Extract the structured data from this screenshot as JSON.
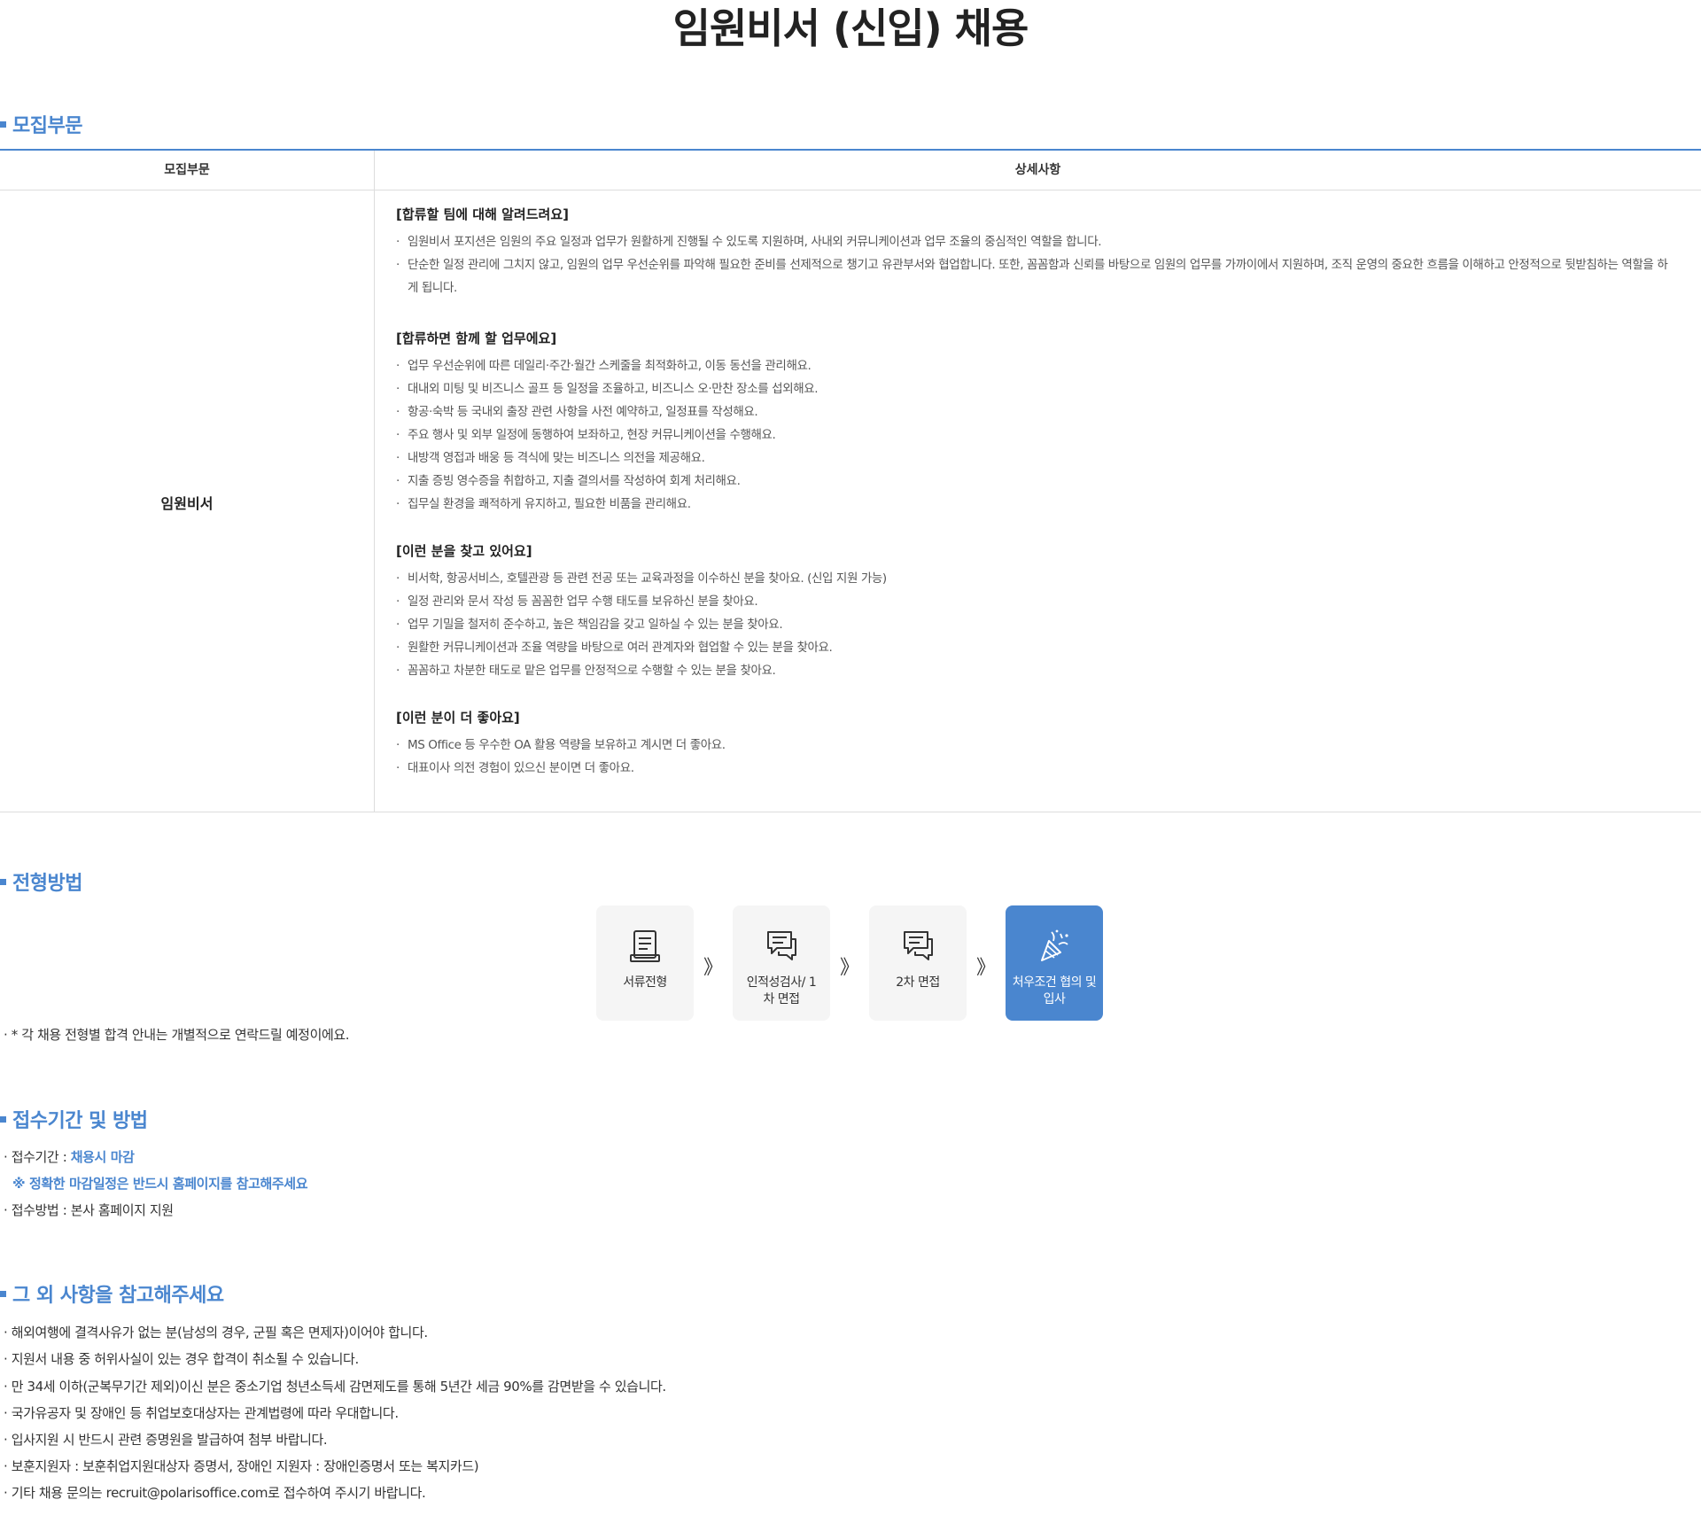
{
  "title": "임원비서 (신입) 채용",
  "sections": {
    "recruit": "모집부문",
    "process": "전형방법",
    "apply": "접수기간 및 방법",
    "other": "그 외 사항을 참고해주세요"
  },
  "table": {
    "col1": "모집부문",
    "col2": "상세사항",
    "dept": "임원비서",
    "groups": [
      {
        "title": "[합류할 팀에 대해 알려드려요]",
        "items": [
          "임원비서 포지션은 임원의 주요 일정과 업무가 원활하게 진행될 수 있도록 지원하며, 사내외 커뮤니케이션과 업무 조율의 중심적인 역할을 합니다.",
          "단순한 일정 관리에 그치지 않고, 임원의 업무 우선순위를 파악해 필요한 준비를 선제적으로 챙기고 유관부서와 협업합니다. 또한, 꼼꼼함과 신뢰를 바탕으로 임원의 업무를 가까이에서 지원하며, 조직 운영의 중요한 흐름을 이해하고 안정적으로 뒷받침하는 역할을 하게 됩니다."
        ]
      },
      {
        "title": "[합류하면 함께 할 업무에요]",
        "items": [
          "업무 우선순위에 따른 데일리·주간·월간 스케줄을 최적화하고, 이동 동선을 관리해요.",
          "대내외 미팅 및 비즈니스 골프 등 일정을 조율하고, 비즈니스 오·만찬 장소를 섭외해요.",
          "항공·숙박 등 국내외 출장 관련 사항을 사전 예약하고, 일정표를 작성해요.",
          "주요 행사 및 외부 일정에 동행하여 보좌하고, 현장 커뮤니케이션을 수행해요.",
          "내방객 영접과 배웅 등 격식에 맞는 비즈니스 의전을 제공해요.",
          "지출 증빙 영수증을 취합하고, 지출 결의서를 작성하여 회계 처리해요.",
          "집무실 환경을 쾌적하게 유지하고, 필요한 비품을 관리해요."
        ]
      },
      {
        "title": "[이런 분을 찾고 있어요]",
        "items": [
          "비서학, 항공서비스, 호텔관광 등 관련 전공 또는 교육과정을 이수하신 분을 찾아요. (신입 지원 가능)",
          "일정 관리와 문서 작성 등 꼼꼼한 업무 수행 태도를 보유하신 분을 찾아요.",
          "업무 기밀을 철저히 준수하고, 높은 책임감을 갖고 일하실 수 있는 분을 찾아요.",
          "원활한 커뮤니케이션과 조율 역량을 바탕으로 여러 관계자와 협업할 수 있는 분을 찾아요.",
          "꼼꼼하고 차분한 태도로 맡은 업무를 안정적으로 수행할 수 있는 분을 찾아요."
        ]
      },
      {
        "title": "[이런 분이 더 좋아요]",
        "items": [
          "MS Office 등 우수한 OA 활용 역량을 보유하고 계시면 더 좋아요.",
          "대표이사 의전 경험이 있으신 분이면 더 좋아요."
        ]
      }
    ]
  },
  "process": {
    "steps": [
      {
        "label": "서류전형",
        "icon": "document-icon"
      },
      {
        "label": "인적성검사/ 1차 면접",
        "icon": "chat-icon"
      },
      {
        "label": "2차 면접",
        "icon": "chat-icon"
      },
      {
        "label": "처우조건 협의 및 입사",
        "icon": "party-icon"
      }
    ],
    "arrow": "》",
    "note": "· * 각 채용 전형별 합격 안내는 개별적으로 연락드릴 예정이에요."
  },
  "apply": {
    "period_label": "· 접수기간 : ",
    "period_value": "채용시 마감",
    "period_note": "※ 정확한 마감일정은 반드시 홈페이지를 참고해주세요",
    "method": "· 접수방법 : 본사 홈페이지 지원"
  },
  "other": [
    "· 해외여행에 결격사유가 없는 분(남성의 경우, 군필 혹은 면제자)이어야 합니다.",
    "· 지원서 내용 중 허위사실이 있는 경우 합격이 취소될 수 있습니다.",
    "· 만 34세 이하(군복무기간 제외)이신 분은 중소기업 청년소득세 감면제도를 통해 5년간 세금 90%를 감면받을 수 있습니다.",
    "· 국가유공자 및 장애인 등 취업보호대상자는 관계법령에 따라 우대합니다.",
    "·  입사지원 시 반드시 관련 증명원을 발급하여 첨부 바랍니다.",
    "· 보훈지원자 : 보훈취업지원대상자 증명서, 장애인 지원자 : 장애인증명서 또는 복지카드)",
    "· 기타 채용 문의는 recruit@polarisoffice.com로 접수하여 주시기 바랍니다."
  ],
  "colors": {
    "accent": "#4a86cf"
  }
}
